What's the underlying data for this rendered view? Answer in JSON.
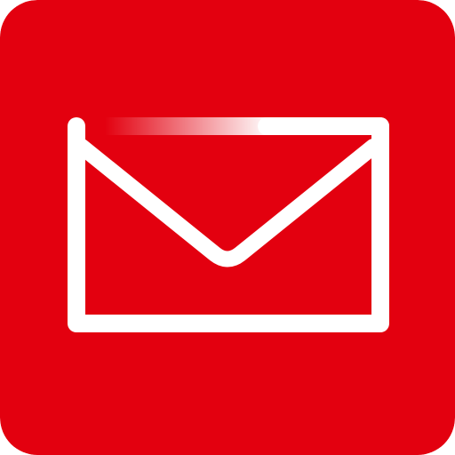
{
  "app_icon": {
    "icon": "envelope-icon",
    "background_color": "#E3000F",
    "glyph_color": "#FFFFFF"
  }
}
